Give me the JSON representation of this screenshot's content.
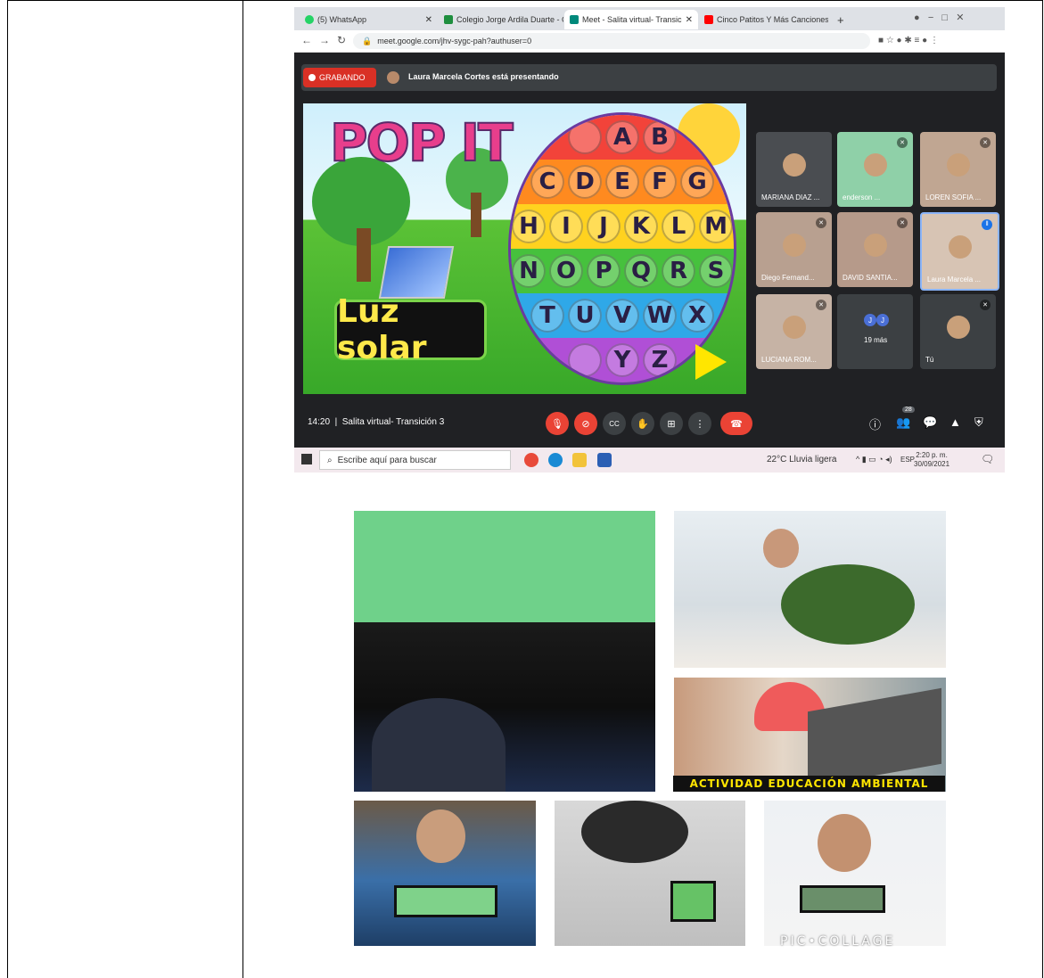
{
  "browser": {
    "tabs": [
      {
        "label": "(5) WhatsApp",
        "icon": "whatsapp-icon",
        "color": "#25d366"
      },
      {
        "label": "Colegio Jorge Ardila Duarte - Ca",
        "icon": "classroom-icon",
        "color": "#1e8e3e"
      },
      {
        "label": "Meet - Salita virtual- Transic",
        "icon": "meet-icon",
        "color": "#00897b"
      },
      {
        "label": "Cinco Patitos Y Más Canciones In",
        "icon": "youtube-icon",
        "color": "#ff0000"
      }
    ],
    "new_tab": "+",
    "url": "meet.google.com/jhv-sygc-pah?authuser=0"
  },
  "meet": {
    "recording_label": "GRABANDO",
    "presenting_text": "Laura Marcela Cortes está presentando",
    "participants": [
      {
        "name": "MARIANA DIAZ ..."
      },
      {
        "name": "enderson ..."
      },
      {
        "name": "LOREN SOFIA ..."
      },
      {
        "name": "Diego Fernand..."
      },
      {
        "name": "DAVID SANTIA..."
      },
      {
        "name": "Laura Marcela ..."
      },
      {
        "name": "LUCIANA ROM..."
      },
      {
        "name": "19 más"
      },
      {
        "name": "Tú"
      }
    ],
    "more_avatars": [
      "J",
      "J"
    ],
    "time": "14:20",
    "separator": "|",
    "meeting_name": "Salita virtual- Transición 3",
    "participant_count": "28"
  },
  "slide": {
    "title": "POP IT",
    "caption": "Luz solar",
    "rows": [
      {
        "letters": [
          "",
          "A",
          "B"
        ],
        "color": "#f2433a"
      },
      {
        "letters": [
          "C",
          "D",
          "E",
          "F",
          "G"
        ],
        "color": "#ff8a1f"
      },
      {
        "letters": [
          "H",
          "I",
          "J",
          "K",
          "L",
          "M"
        ],
        "color": "#ffd21f"
      },
      {
        "letters": [
          "N",
          "O",
          "P",
          "Q",
          "R",
          "S"
        ],
        "color": "#46c13d"
      },
      {
        "letters": [
          "T",
          "U",
          "V",
          "W",
          "X"
        ],
        "color": "#2fa8e8"
      },
      {
        "letters": [
          "",
          "Y",
          "Z"
        ],
        "color": "#b04fd6"
      }
    ]
  },
  "taskbar": {
    "search_placeholder": "Escribe aquí para buscar",
    "weather": "22°C  Lluvia ligera",
    "lang": "ESP",
    "time": "2:20 p. m.",
    "date": "30/09/2021"
  },
  "collage": {
    "banner": "ACTIVIDAD EDUCACIÓN AMBIENTAL",
    "watermark": "PIC•COLLAGE"
  }
}
